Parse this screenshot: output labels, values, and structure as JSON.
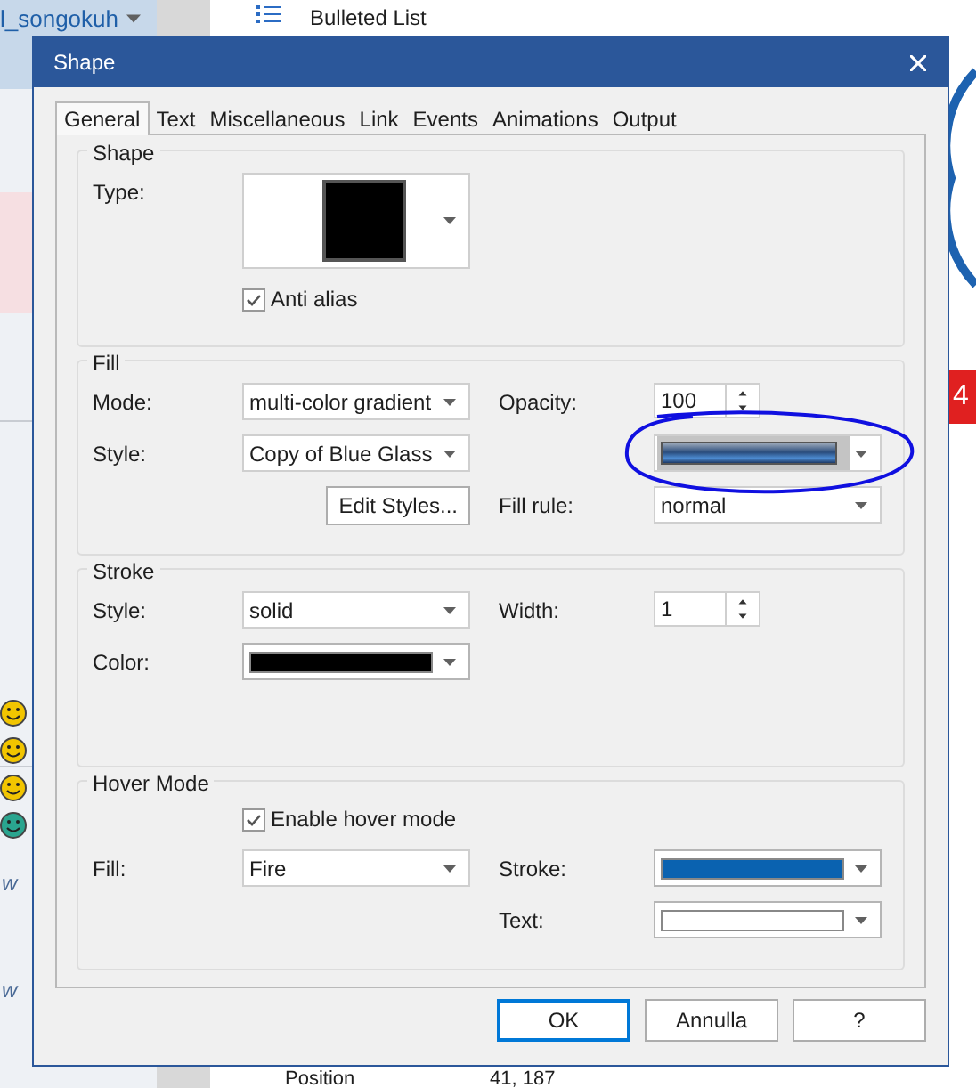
{
  "background": {
    "user_menu": "l_songokuh",
    "list_item": "Bulleted List",
    "property_name": "Position",
    "property_value": "41, 187",
    "badge": "4",
    "fragments": [
      "w",
      "w"
    ]
  },
  "dialog": {
    "title": "Shape",
    "tabs": [
      {
        "label": "General",
        "selected": true
      },
      {
        "label": "Text",
        "selected": false
      },
      {
        "label": "Miscellaneous",
        "selected": false
      },
      {
        "label": "Link",
        "selected": false
      },
      {
        "label": "Events",
        "selected": false
      },
      {
        "label": "Animations",
        "selected": false
      },
      {
        "label": "Output",
        "selected": false
      }
    ],
    "groups": [
      {
        "title": "Shape",
        "rows": [
          {
            "left": {
              "label": "Type:",
              "control": {
                "kind": "shape_picker"
              }
            }
          },
          {
            "left": {
              "control": {
                "kind": "checkbox",
                "label": "Anti alias",
                "checked": true
              }
            }
          }
        ]
      },
      {
        "title": "Fill",
        "rows": [
          {
            "left": {
              "label": "Mode:",
              "control": {
                "kind": "dropdown",
                "value": "multi-color gradient"
              }
            },
            "right": {
              "label": "Opacity:",
              "control": {
                "kind": "spinner",
                "value": "100"
              }
            }
          },
          {
            "left": {
              "label": "Style:",
              "control": {
                "kind": "dropdown",
                "value": "Copy of Blue Glass"
              }
            },
            "right": {
              "control": {
                "kind": "gradient_dropdown",
                "annotated": true
              }
            }
          },
          {
            "left": {
              "control": {
                "kind": "button",
                "label": "Edit Styles..."
              }
            },
            "right": {
              "label": "Fill rule:",
              "control": {
                "kind": "dropdown",
                "value": "normal"
              }
            }
          }
        ]
      },
      {
        "title": "Stroke",
        "rows": [
          {
            "left": {
              "label": "Style:",
              "control": {
                "kind": "dropdown",
                "value": "solid"
              }
            },
            "right": {
              "label": "Width:",
              "control": {
                "kind": "spinner",
                "value": "1"
              }
            }
          },
          {
            "left": {
              "label": "Color:",
              "control": {
                "kind": "color_dropdown",
                "color": "#000000"
              }
            }
          }
        ]
      },
      {
        "title": "Hover Mode",
        "rows": [
          {
            "left": {
              "control": {
                "kind": "checkbox",
                "label": "Enable hover mode",
                "checked": true
              }
            }
          },
          {
            "left": {
              "label": "Fill:",
              "control": {
                "kind": "dropdown",
                "value": "Fire"
              }
            },
            "right": {
              "label": "Stroke:",
              "control": {
                "kind": "color_dropdown",
                "color": "#0a62b0"
              }
            }
          },
          {
            "right": {
              "label": "Text:",
              "control": {
                "kind": "color_dropdown",
                "color": "#ffffff"
              }
            }
          }
        ]
      }
    ],
    "buttons": [
      {
        "label": "OK",
        "default": true
      },
      {
        "label": "Annulla",
        "default": false
      },
      {
        "label": "?",
        "default": false
      }
    ]
  }
}
